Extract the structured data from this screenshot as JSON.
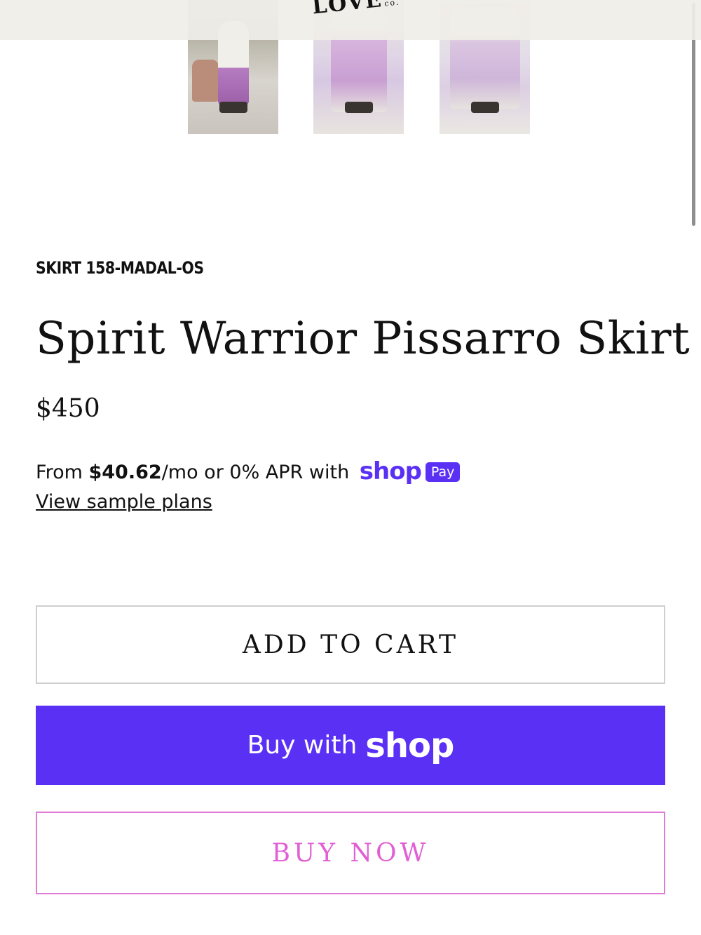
{
  "header": {
    "logo_text": "LOVE",
    "logo_suffix": "co."
  },
  "product": {
    "sku": "SKIRT 158-MADAL-OS",
    "title": "Spirit Warrior Pissarro Skirt",
    "price": "$450"
  },
  "installments": {
    "prefix": "From ",
    "amount": "$40.62",
    "suffix": "/mo or 0% APR with",
    "brand": "shop",
    "badge": "Pay",
    "link": "View sample plans"
  },
  "actions": {
    "add_to_cart": "ADD TO CART",
    "buy_with": "Buy with",
    "buy_with_brand": "shop",
    "buy_now": "BUY NOW"
  },
  "colors": {
    "shop_purple": "#5a31f4",
    "buy_now_pink": "#e060d4"
  }
}
